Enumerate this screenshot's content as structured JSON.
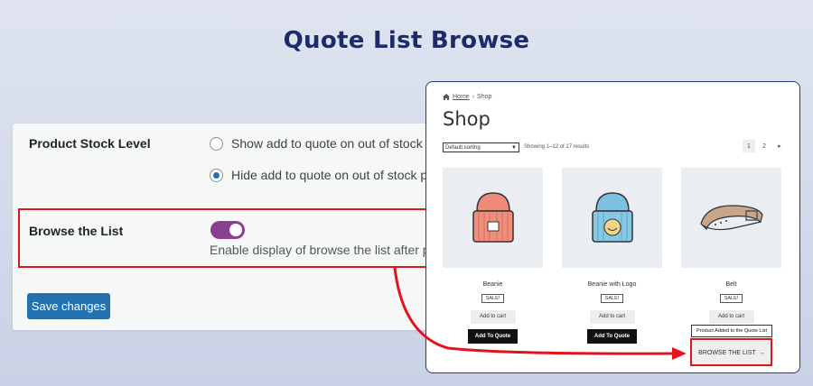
{
  "headline": "Quote List Browse",
  "settings": {
    "stock_label": "Product Stock Level",
    "stock_option_1": "Show add to quote on out of stock pr",
    "stock_option_2": "Hide add to quote on out of stock pro",
    "browse_label": "Browse the List",
    "browse_desc": "Enable display of browse the list after pro",
    "browse_enabled": true,
    "save_label": "Save changes",
    "accent": "#2271b1",
    "toggle_color": "#8a3f8f",
    "highlight_color": "#e0141c"
  },
  "shop": {
    "breadcrumb_home": "Home",
    "breadcrumb_sep": "›",
    "breadcrumb_current": "Shop",
    "title": "Shop",
    "sort_value": "Default sorting",
    "result_count": "Showing 1–12 of 17 results",
    "pages": [
      "1",
      "2"
    ],
    "next_glyph": "▸",
    "products": [
      {
        "name": "Beanie",
        "badge": "SALE!",
        "cart": "Add to cart",
        "quote": "Add To Quote"
      },
      {
        "name": "Beanie with Logo",
        "badge": "SALE!",
        "cart": "Add to cart",
        "quote": "Add To Quote"
      },
      {
        "name": "Belt",
        "badge": "SALE!",
        "cart": "Add to cart"
      }
    ],
    "added_notice": "Product Added to the Quote List",
    "browse_button": "BROWSE THE LIST",
    "browse_arrow": "→"
  }
}
